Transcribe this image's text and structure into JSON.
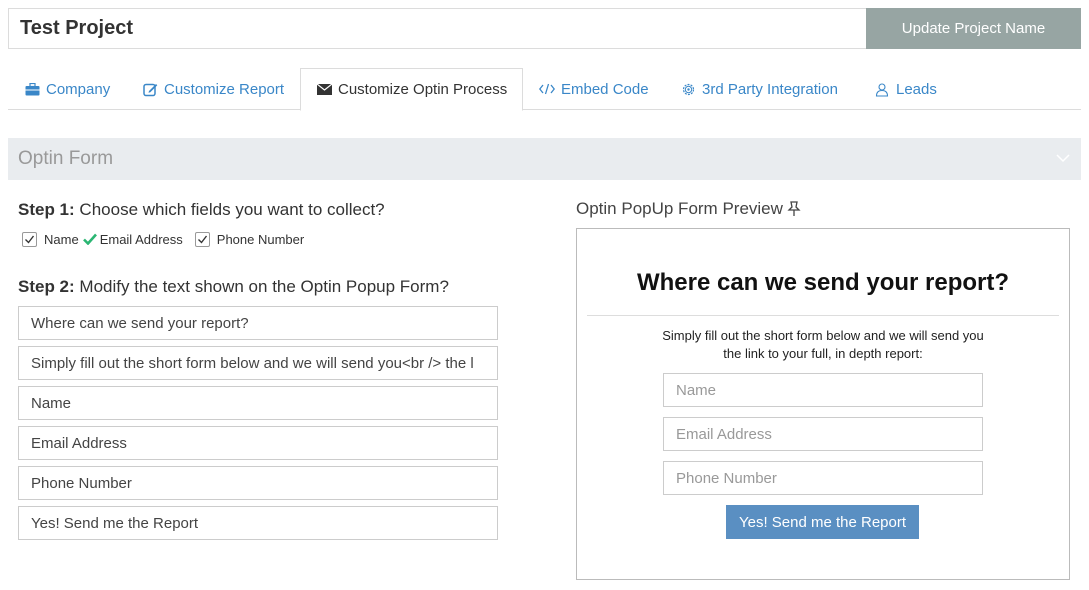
{
  "project": {
    "title": "Test Project",
    "update_button": "Update Project Name"
  },
  "tabs": [
    {
      "label": "Company",
      "icon": "briefcase-icon"
    },
    {
      "label": "Customize Report",
      "icon": "edit-icon"
    },
    {
      "label": "Customize Optin Process",
      "icon": "envelope-icon",
      "active": true
    },
    {
      "label": "Embed Code",
      "icon": "code-icon"
    },
    {
      "label": "3rd Party Integration",
      "icon": "gear-icon"
    },
    {
      "label": "Leads",
      "icon": "users-icon"
    }
  ],
  "section": {
    "title": "Optin Form"
  },
  "step1": {
    "label": "Step 1:",
    "text": "Choose which fields you want to collect?",
    "fields": [
      {
        "label": "Name",
        "checked": true
      },
      {
        "label": "Email Address",
        "checked": true
      },
      {
        "label": "Phone Number",
        "checked": true
      }
    ]
  },
  "step2": {
    "label": "Step 2:",
    "text": "Modify the text shown on the Optin Popup Form?",
    "inputs": [
      "Where can we send your report?",
      "Simply fill out the short form below and we will send you<br /> the l",
      "Name",
      "Email Address",
      "Phone Number",
      "Yes! Send me the Report"
    ]
  },
  "preview": {
    "title": "Optin PopUp Form Preview",
    "headline": "Where can we send your report?",
    "subtext_line1": "Simply fill out the short form below and we will send you",
    "subtext_line2": "the link to your full, in depth report:",
    "placeholders": [
      "Name",
      "Email Address",
      "Phone Number"
    ],
    "button": "Yes! Send me the Report"
  },
  "colors": {
    "accent": "#3a87c8",
    "update_button_bg": "#97a5a3",
    "preview_button_bg": "#5a8fc2",
    "check_green": "#2bb673"
  }
}
